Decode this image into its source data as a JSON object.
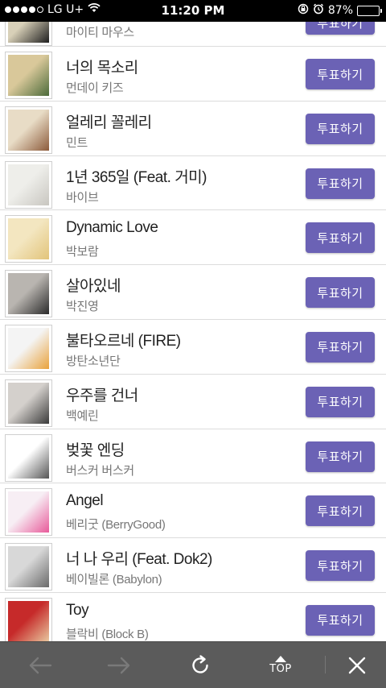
{
  "status_bar": {
    "carrier": "LG U+",
    "time": "11:20 PM",
    "battery_percent": "87%",
    "battery_level": 0.87,
    "signal_bars_filled": 4
  },
  "vote_label": "투표하기",
  "songs": [
    {
      "title": "",
      "artist": "마이티 마우스",
      "thumb_colors": [
        "#d8d0b8",
        "#1e1e1e"
      ]
    },
    {
      "title": "너의 목소리",
      "artist": "먼데이 키즈",
      "thumb_colors": [
        "#d9c89a",
        "#4c6b3a"
      ]
    },
    {
      "title": "얼레리 꼴레리",
      "artist": "민트",
      "thumb_colors": [
        "#e8dcc6",
        "#8c5a3a"
      ]
    },
    {
      "title": "1년 365일 (Feat. 거미)",
      "artist": "바이브",
      "thumb_colors": [
        "#eeeeea",
        "#c8c6c0"
      ]
    },
    {
      "title": "Dynamic Love",
      "artist": "박보람",
      "thumb_colors": [
        "#f3e6c0",
        "#e2c47a"
      ]
    },
    {
      "title": "살아있네",
      "artist": "박진영",
      "thumb_colors": [
        "#b9b5b0",
        "#2a2a2a"
      ]
    },
    {
      "title": "불타오르네 (FIRE)",
      "artist": "방탄소년단",
      "thumb_colors": [
        "#f4f4f4",
        "#e9a23b"
      ]
    },
    {
      "title": "우주를 건너",
      "artist": "백예린",
      "thumb_colors": [
        "#d4d0cc",
        "#3a3a3a"
      ]
    },
    {
      "title": "벚꽃 엔딩",
      "artist": "버스커 버스커",
      "thumb_colors": [
        "#ffffff",
        "#555555"
      ]
    },
    {
      "title": "Angel",
      "artist": "베리굿 (BerryGood)",
      "thumb_colors": [
        "#f7eef4",
        "#e85a9a"
      ]
    },
    {
      "title": "너 나 우리 (Feat. Dok2)",
      "artist": "베이빌론 (Babylon)",
      "thumb_colors": [
        "#d8d8d8",
        "#6a6a6a"
      ]
    },
    {
      "title": "Toy",
      "artist": "블락비 (Block B)",
      "thumb_colors": [
        "#c62a2a",
        "#e8c9a0"
      ]
    }
  ],
  "toolbar": {
    "top_label": "TOP"
  },
  "colors": {
    "vote_button": "#6b62b5",
    "toolbar_bg": "#5b5b5b"
  }
}
